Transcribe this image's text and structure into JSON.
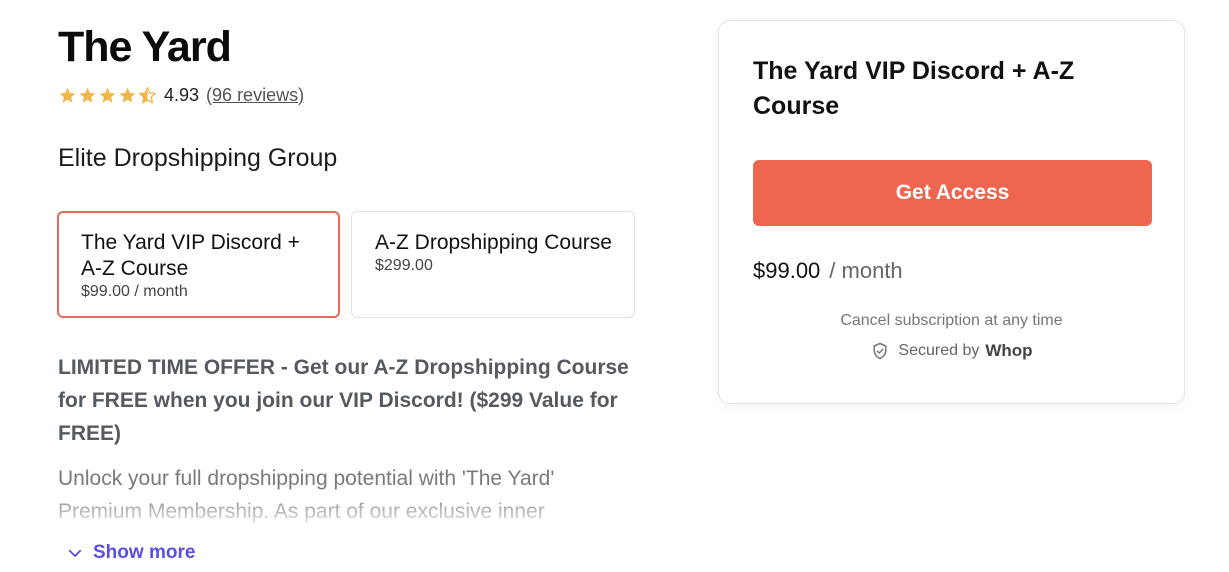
{
  "product": {
    "title": "The Yard",
    "rating": {
      "value": 4.93,
      "display": "4.93",
      "reviews_text": "(96 reviews)",
      "star_color": "#f0b64a"
    },
    "tagline": "Elite Dropshipping Group"
  },
  "plans": [
    {
      "name": "The Yard VIP Discord + A-Z Course",
      "price": "$99.00 / month",
      "selected": true
    },
    {
      "name": "A-Z Dropshipping Course",
      "price": "$299.00",
      "selected": false
    }
  ],
  "description": {
    "offer": "LIMITED TIME OFFER - Get our A-Z Dropshipping Course for FREE when you join our VIP Discord! ($299 Value for FREE)",
    "body": "Unlock your full dropshipping potential with 'The Yard' Premium Membership. As part of our exclusive inner",
    "show_more": "Show more"
  },
  "checkout": {
    "title": "The Yard VIP Discord + A-Z Course",
    "button": "Get Access",
    "price": "$99.00",
    "period": "/ month",
    "cancel_note": "Cancel subscription at any time",
    "secured_by": "Secured by",
    "brand": "Whop"
  },
  "colors": {
    "accent": "#ee664f",
    "selected_border": "#e8685a",
    "link": "#5a4fe0"
  }
}
